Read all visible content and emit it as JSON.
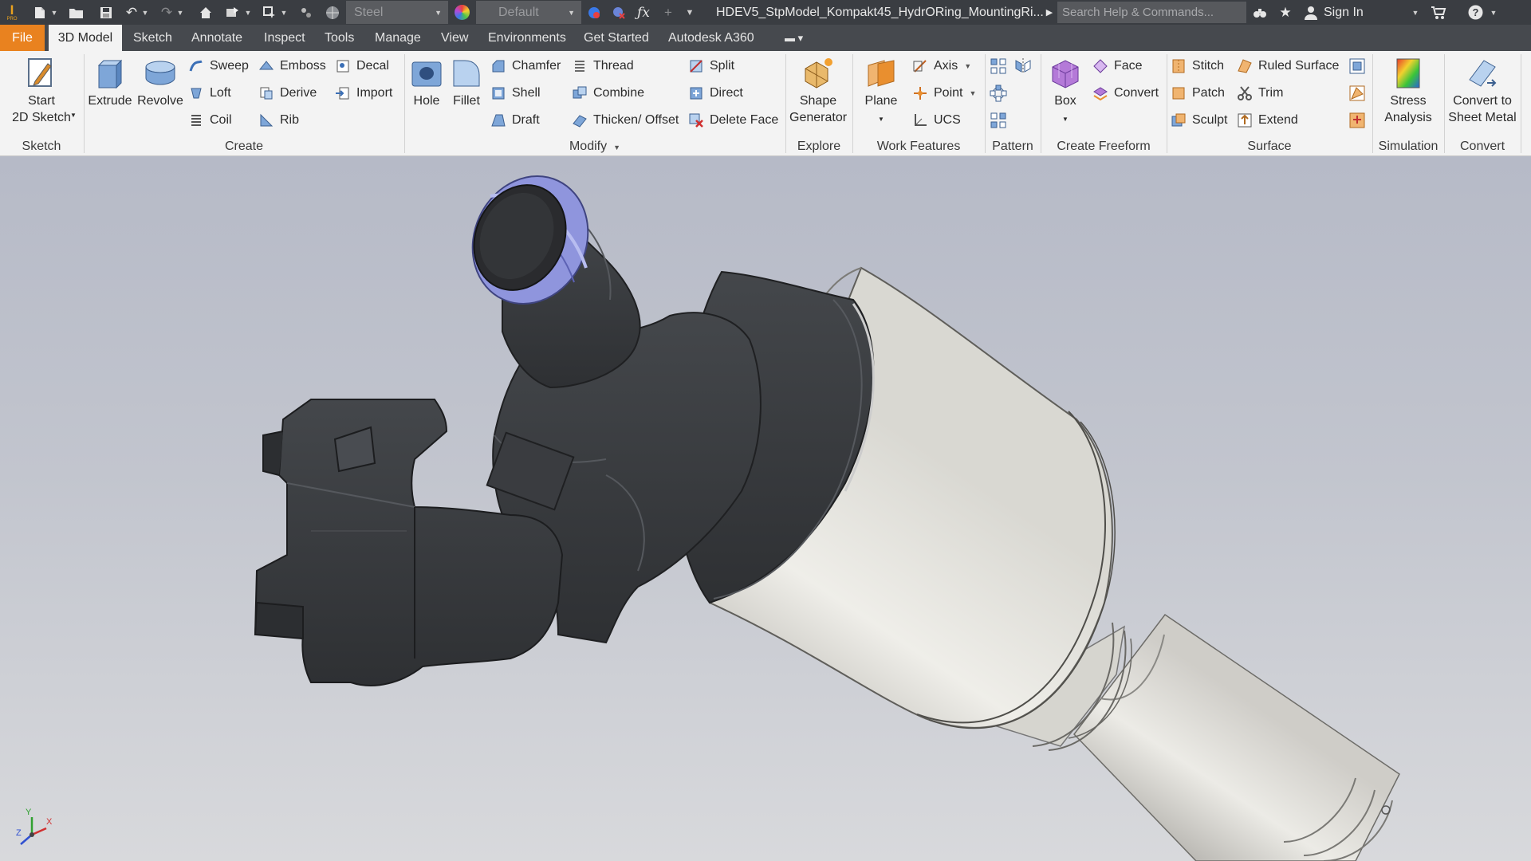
{
  "titlebar": {
    "app_logo": "inventor-logo",
    "app_logo_sub": "PRO",
    "material": "Steel",
    "appearance": "Default",
    "document_title": "HDEV5_StpModel_Kompakt45_HydrORing_MountingRi...",
    "search_placeholder": "Search Help & Commands...",
    "sign_in": "Sign In",
    "colors": {
      "bar": "#3a3d42",
      "accent": "#e9821f"
    }
  },
  "tabs": [
    {
      "label": "File"
    },
    {
      "label": "3D Model",
      "active": true
    },
    {
      "label": "Sketch"
    },
    {
      "label": "Annotate"
    },
    {
      "label": "Inspect"
    },
    {
      "label": "Tools"
    },
    {
      "label": "Manage"
    },
    {
      "label": "View"
    },
    {
      "label": "Environments"
    },
    {
      "label": "Get Started"
    },
    {
      "label": "Autodesk A360"
    }
  ],
  "ribbon": {
    "sketch": {
      "start_line1": "Start",
      "start_line2": "2D Sketch",
      "group": "Sketch"
    },
    "create": {
      "extrude": "Extrude",
      "revolve": "Revolve",
      "sweep": "Sweep",
      "loft": "Loft",
      "coil": "Coil",
      "emboss": "Emboss",
      "derive": "Derive",
      "rib": "Rib",
      "decal": "Decal",
      "import": "Import",
      "group": "Create"
    },
    "modify": {
      "hole": "Hole",
      "fillet": "Fillet",
      "chamfer": "Chamfer",
      "shell": "Shell",
      "draft": "Draft",
      "thread": "Thread",
      "combine": "Combine",
      "thicken": "Thicken/ Offset",
      "split": "Split",
      "direct": "Direct",
      "delete_face": "Delete Face",
      "group": "Modify"
    },
    "explore": {
      "shape_line1": "Shape",
      "shape_line2": "Generator",
      "group": "Explore"
    },
    "work_features": {
      "plane": "Plane",
      "axis": "Axis",
      "point": "Point",
      "ucs": "UCS",
      "group": "Work Features"
    },
    "pattern": {
      "group": "Pattern"
    },
    "freeform": {
      "box": "Box",
      "face": "Face",
      "convert": "Convert",
      "group": "Create Freeform"
    },
    "surface": {
      "stitch": "Stitch",
      "patch": "Patch",
      "sculpt": "Sculpt",
      "ruled": "Ruled Surface",
      "trim": "Trim",
      "extend": "Extend",
      "group": "Surface"
    },
    "simulation": {
      "stress_line1": "Stress",
      "stress_line2": "Analysis",
      "group": "Simulation"
    },
    "convert": {
      "sheet_line1": "Convert to",
      "sheet_line2": "Sheet Metal",
      "group": "Convert"
    }
  },
  "viewport": {
    "model": "fuel injector model",
    "triad": {
      "x": "X",
      "y": "Y",
      "z": "Z"
    },
    "colors": {
      "body": "#3b3d40",
      "sleeve": "#e6e5e0",
      "oring": "#8f95dd"
    }
  }
}
